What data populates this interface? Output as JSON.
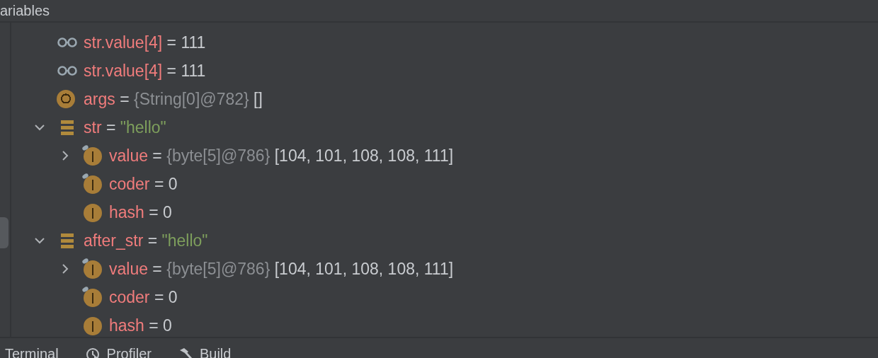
{
  "panel": {
    "title": "ariables"
  },
  "tree": [
    {
      "kind": "watch",
      "name": "str.value[4]",
      "separator": "=",
      "value": "111"
    },
    {
      "kind": "watch",
      "name": "str.value[4]",
      "separator": "=",
      "value": "111"
    },
    {
      "kind": "param",
      "name": "args",
      "separator": "=",
      "type": "{String[0]@782}",
      "value": "[]"
    },
    {
      "kind": "local",
      "name": "str",
      "separator": "=",
      "value": "\"hello\"",
      "string_value": true,
      "expanded": true,
      "children": [
        {
          "kind": "field",
          "name": "value",
          "separator": "=",
          "type": "{byte[5]@786}",
          "value": "[104, 101, 108, 108, 111]",
          "pinned": true,
          "expanded": false
        },
        {
          "kind": "field",
          "name": "coder",
          "separator": "=",
          "value": "0",
          "pinned": true
        },
        {
          "kind": "field",
          "name": "hash",
          "separator": "=",
          "value": "0",
          "pinned": false
        }
      ]
    },
    {
      "kind": "local",
      "name": "after_str",
      "separator": "=",
      "value": "\"hello\"",
      "string_value": true,
      "expanded": true,
      "children": [
        {
          "kind": "field",
          "name": "value",
          "separator": "=",
          "type": "{byte[5]@786}",
          "value": "[104, 101, 108, 108, 111]",
          "pinned": true,
          "expanded": false
        },
        {
          "kind": "field",
          "name": "coder",
          "separator": "=",
          "value": "0",
          "pinned": true
        },
        {
          "kind": "field",
          "name": "hash",
          "separator": "=",
          "value": "0",
          "pinned": false
        }
      ]
    }
  ],
  "bottom_tabs": [
    {
      "kind": "plain",
      "label": "Terminal"
    },
    {
      "kind": "profiler",
      "label": "Profiler"
    },
    {
      "kind": "build",
      "label": "Build"
    }
  ]
}
